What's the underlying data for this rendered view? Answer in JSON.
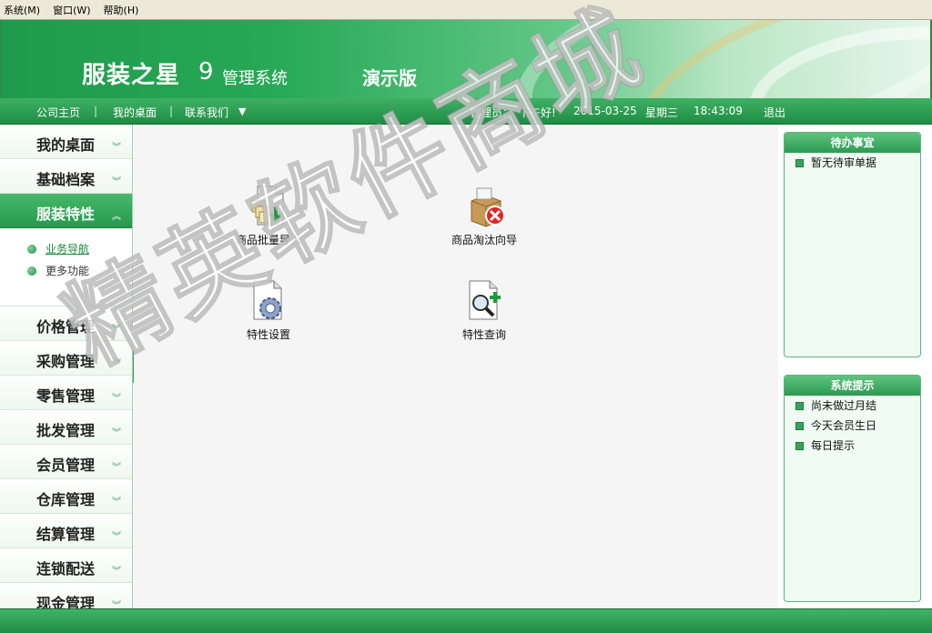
{
  "menubar": {
    "items": [
      "系统(M)",
      "窗口(W)",
      "帮助(H)"
    ]
  },
  "banner": {
    "brand": "服装之星",
    "version": "9",
    "subtitle": "管理系统",
    "edition": "演示版"
  },
  "nav": {
    "links": [
      "公司主页",
      "我的桌面",
      "联系我们"
    ],
    "separator": "|",
    "dropdown_arrow": "▼",
    "admin_label": "管理员：",
    "greeting": "下午好!",
    "date": "2015-03-25",
    "weekday": "星期三",
    "time": "18:43:09",
    "logout": "退出"
  },
  "sidebar": {
    "items": [
      {
        "label": "我的桌面",
        "active": false
      },
      {
        "label": "基础档案",
        "active": false
      },
      {
        "label": "服装特性",
        "active": true
      },
      {
        "label": "价格管理",
        "active": false
      },
      {
        "label": "采购管理",
        "active": false
      },
      {
        "label": "零售管理",
        "active": false
      },
      {
        "label": "批发管理",
        "active": false
      },
      {
        "label": "会员管理",
        "active": false
      },
      {
        "label": "仓库管理",
        "active": false
      },
      {
        "label": "结算管理",
        "active": false
      },
      {
        "label": "连锁配送",
        "active": false
      },
      {
        "label": "现金管理",
        "active": false
      }
    ],
    "sub_items": [
      "业务导航",
      "更多功能"
    ],
    "chevron_down": "︾",
    "chevron_up": "︽",
    "handle": "▸"
  },
  "main": {
    "tiles": [
      {
        "label": "商品批量导入",
        "icon": "batch-import-icon"
      },
      {
        "label": "商品淘汰向导",
        "icon": "box-remove-icon"
      },
      {
        "label": "特性设置",
        "icon": "gear-doc-icon"
      },
      {
        "label": "特性查询",
        "icon": "magnifier-doc-icon"
      }
    ]
  },
  "panels": {
    "todo": {
      "title": "待办事宜",
      "items": [
        "暂无待审单据"
      ]
    },
    "tips": {
      "title": "系统提示",
      "items": [
        "尚未做过月结",
        "今天会员生日",
        "每日提示"
      ]
    }
  },
  "watermark": "精英软件商城",
  "colors": {
    "primary_green": "#26994c",
    "panel_bg": "#f0fbf3",
    "main_bg": "#f5f5f5"
  }
}
